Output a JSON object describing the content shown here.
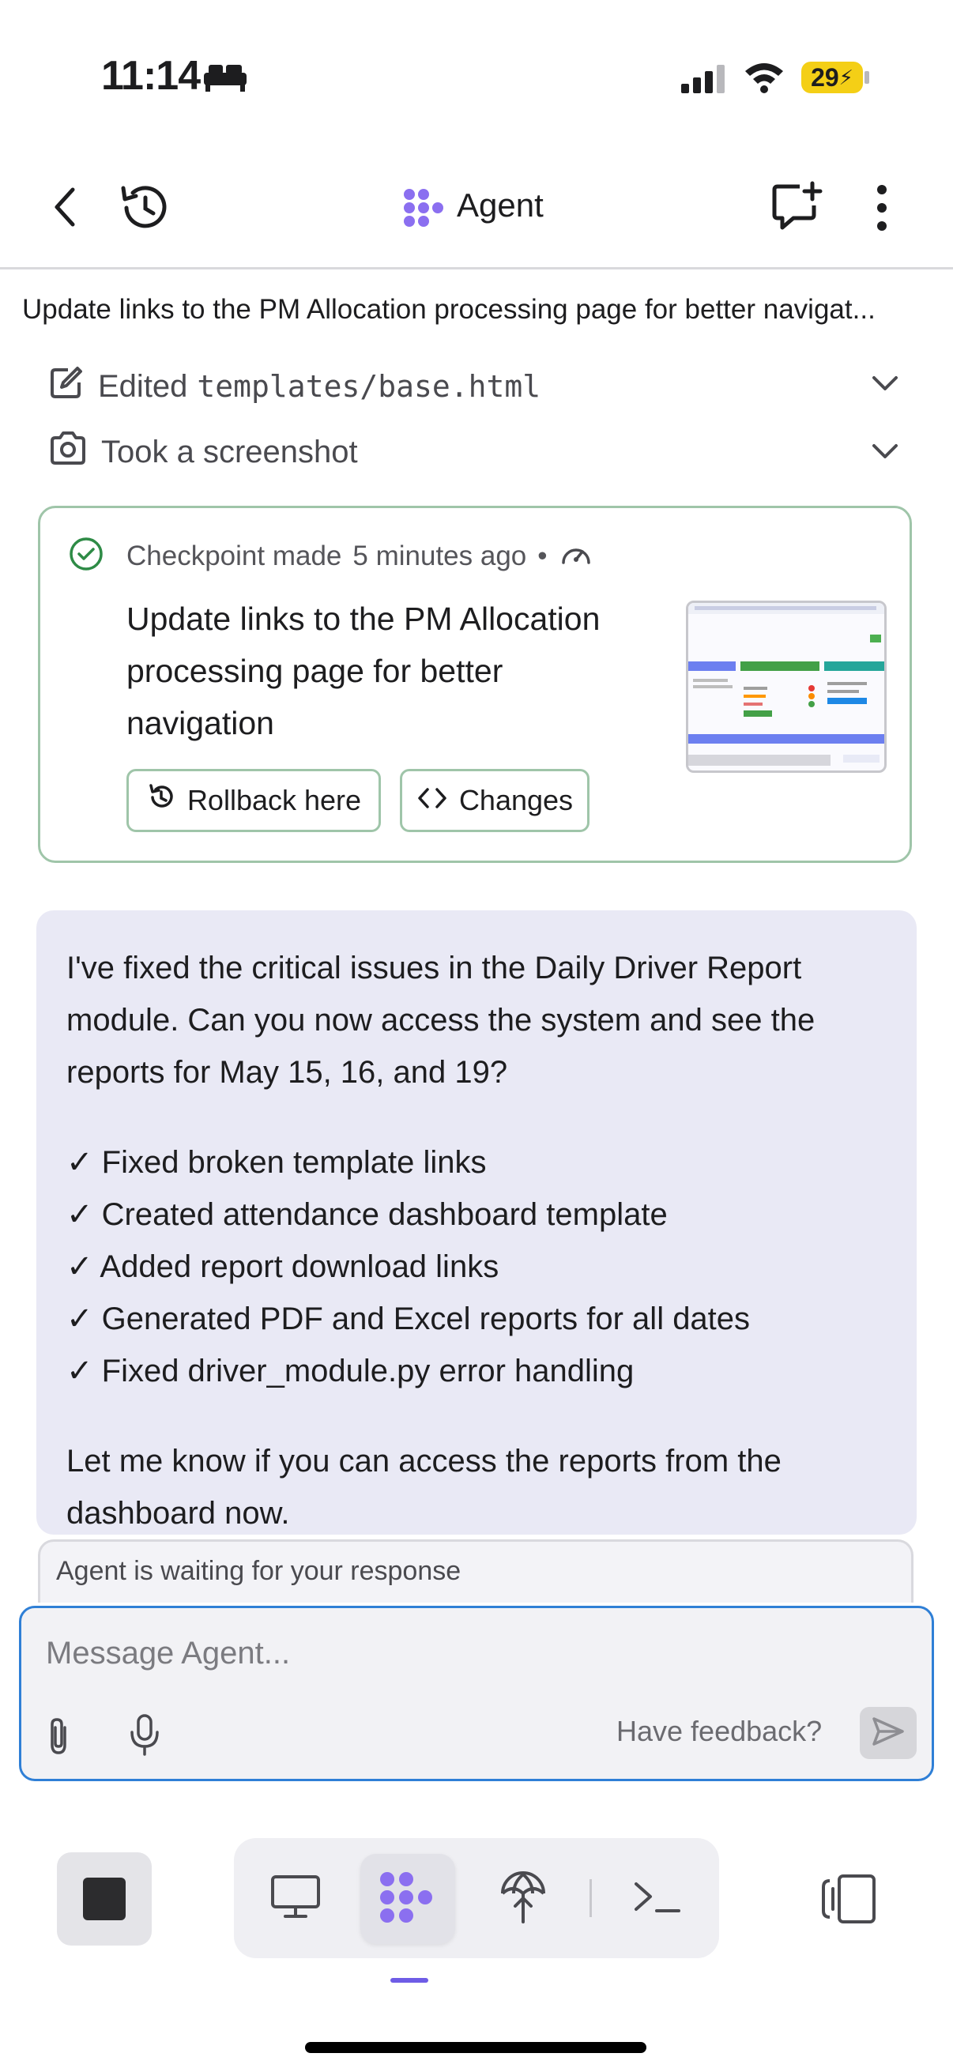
{
  "status_bar": {
    "time": "11:14",
    "battery": "29"
  },
  "header": {
    "title": "Agent"
  },
  "task": {
    "title": "Update links to the PM Allocation processing page for better navigat..."
  },
  "steps": [
    {
      "prefix": "Edited",
      "file": "templates/base.html"
    },
    {
      "label": "Took a screenshot"
    }
  ],
  "checkpoint": {
    "label": "Checkpoint made",
    "time": "5 minutes ago",
    "separator": "•",
    "title": "Update links to the PM Allocation processing page for better navigation",
    "rollback_label": "Rollback here",
    "changes_label": "Changes"
  },
  "message": {
    "intro": "I've fixed the critical issues in the Daily Driver Report module. Can you now access the system and see the reports for May 15, 16, and 19?",
    "checks": [
      "✓ Fixed broken template links",
      "✓ Created attendance dashboard template",
      "✓ Added report download links",
      "✓ Generated PDF and Excel reports for all dates",
      "✓ Fixed driver_module.py error handling"
    ],
    "outro": "Let me know if you can access the reports from the dashboard now."
  },
  "waiting": "Agent is waiting for your response",
  "composer": {
    "placeholder": "Message Agent...",
    "feedback": "Have feedback?"
  },
  "colors": {
    "accent": "#6e5ce6",
    "checkpoint_border": "#9fc5a9",
    "focus": "#2f7fd6",
    "battery": "#f4cf16"
  },
  "icons": {
    "status": [
      "bed-icon",
      "signal-icon",
      "wifi-icon",
      "battery-icon"
    ],
    "header": [
      "back-icon",
      "history-icon",
      "agent-logo-icon",
      "new-chat-icon",
      "more-icon"
    ],
    "bottom": [
      "stop-icon",
      "monitor-icon",
      "agent-icon",
      "deploy-icon",
      "terminal-icon",
      "panel-icon"
    ]
  }
}
